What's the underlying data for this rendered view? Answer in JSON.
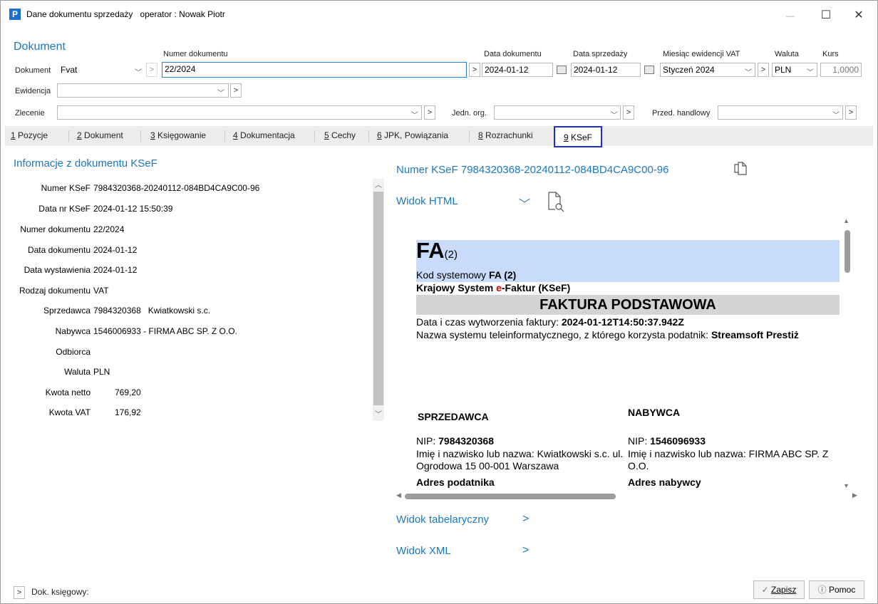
{
  "window": {
    "app_logo": "P",
    "title": "Dane dokumentu sprzedaży",
    "operator": "operator : Nowak Piotr",
    "minimize": "—",
    "maximize": "☐",
    "close": "✕"
  },
  "header": {
    "section_title": "Dokument",
    "dokument_label": "Dokument",
    "dokument_value": "Fvat",
    "numer_label": "Numer dokumentu",
    "numer_value": "22/2024",
    "data_dok_label": "Data dokumentu",
    "data_dok_value": "2024-01-12",
    "data_sprz_label": "Data sprzedaży",
    "data_sprz_value": "2024-01-12",
    "miesiac_label": "Miesiąc ewidencji VAT",
    "miesiac_value": "Styczeń 2024",
    "waluta_label": "Waluta",
    "waluta_value": "PLN",
    "kurs_label": "Kurs",
    "kurs_value": "1,0000",
    "ewidencja_label": "Ewidencja",
    "zlecenie_label": "Zlecenie",
    "jedn_label": "Jedn. org.",
    "przed_label": "Przed. handlowy"
  },
  "tabs": [
    {
      "num": "1",
      "label": " Pozycje"
    },
    {
      "num": "2",
      "label": " Dokument"
    },
    {
      "num": "3",
      "label": " Księgowanie"
    },
    {
      "num": "4",
      "label": " Dokumentacja"
    },
    {
      "num": "5",
      "label": " Cechy"
    },
    {
      "num": "6",
      "label": " JPK, Powiązania"
    },
    {
      "num": "8",
      "label": " Rozrachunki"
    },
    {
      "num": "9",
      "label": " KSeF"
    }
  ],
  "info": {
    "title": "Informacje z dokumentu KSeF",
    "rows": [
      {
        "label": "Numer KSeF",
        "value": "7984320368-20240112-084BD4CA9C00-96"
      },
      {
        "label": "Data nr KSeF",
        "value": "2024-01-12 15:50:39"
      },
      {
        "label": "Numer dokumentu",
        "value": "22/2024"
      },
      {
        "label": "Data dokumentu",
        "value": "2024-01-12"
      },
      {
        "label": "Data wystawienia",
        "value": "2024-01-12"
      },
      {
        "label": "Rodzaj dokumentu",
        "value": "VAT"
      },
      {
        "label": "Sprzedawca",
        "value": "7984320368   Kwiatkowski s.c."
      },
      {
        "label": "Nabywca",
        "value": "1546006933 - FIRMA ABC SP. Z O.O."
      },
      {
        "label": "Odbiorca",
        "value": ""
      },
      {
        "label": "Waluta",
        "value": "PLN"
      },
      {
        "label": "Kwota netto",
        "value": "769,20"
      },
      {
        "label": "Kwota VAT",
        "value": "176,92"
      }
    ]
  },
  "ksef": {
    "numer_link": "Numer KSeF 7984320368-20240112-084BD4CA9C00-96",
    "widok_html": "Widok HTML",
    "widok_tab": "Widok tabelaryczny",
    "widok_xml": "Widok XML"
  },
  "invoice": {
    "fa": "FA",
    "fa_variant": "(2)",
    "kod_label": "Kod systemowy ",
    "kod_value": "FA (2)",
    "krajowy_pre": "Krajowy System ",
    "krajowy_e": "e",
    "krajowy_post": "-Faktur (KSeF)",
    "faktura_title": "FAKTURA PODSTAWOWA",
    "data_czas_label": "Data i czas wytworzenia faktury: ",
    "data_czas_value": "2024-01-12T14:50:37.942Z",
    "nazwa_label": "Nazwa systemu teleinformatycznego, z którego korzysta podatnik: ",
    "nazwa_value": "Streamsoft Prestiż",
    "sprzedawca": "SPRZEDAWCA",
    "nabywca": "NABYWCA",
    "nip_label": "NIP: ",
    "nip_s": "7984320368",
    "nip_n": "1546096933",
    "imie_label": "Imię i nazwisko lub nazwa: ",
    "sprz_name": "Kwiatkowski s.c. ul. Ogrodowa 15 00-001 Warszawa",
    "nab_name": "FIRMA ABC SP. Z O.O.",
    "adres_pod": "Adres podatnika",
    "adres_nab": "Adres nabywcy"
  },
  "footer": {
    "dok_ksiegowy": "Dok. księgowy:",
    "zapisz": "Zapisz",
    "pomoc": "Pomoc"
  }
}
